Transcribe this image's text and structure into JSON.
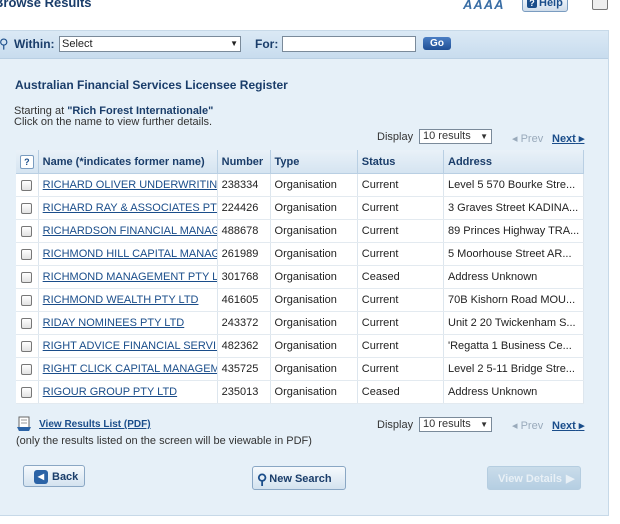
{
  "header": {
    "title": "Browse Results",
    "font_sizes": "AAAA",
    "help_label": "Help"
  },
  "search": {
    "within_label": "Within:",
    "within_selected": "Select",
    "for_label": "For:",
    "for_value": "",
    "go_label": "Go"
  },
  "register_title": "Australian Financial Services Licensee Register",
  "intro": {
    "starting_prefix": "Starting at",
    "starting_name": "\"Rich Forest Internationale\"",
    "instruction": "Click on the name to view further details."
  },
  "pagination": {
    "display_label": "Display",
    "display_value": "10 results",
    "prev_label": "Prev",
    "next_label": "Next"
  },
  "table": {
    "columns": [
      "Name (*indicates former name)",
      "Number",
      "Type",
      "Status",
      "Address"
    ],
    "rows": [
      {
        "name": "RICHARD OLIVER UNDERWRITIN...",
        "number": "238334",
        "type": "Organisation",
        "status": "Current",
        "address": "Level 5 570 Bourke Stre..."
      },
      {
        "name": "RICHARD RAY & ASSOCIATES PTY...",
        "number": "224426",
        "type": "Organisation",
        "status": "Current",
        "address": "3 Graves Street KADINA..."
      },
      {
        "name": "RICHARDSON FINANCIAL MANAG...",
        "number": "488678",
        "type": "Organisation",
        "status": "Current",
        "address": "89 Princes Highway TRA..."
      },
      {
        "name": "RICHMOND HILL CAPITAL MANAG...",
        "number": "261989",
        "type": "Organisation",
        "status": "Current",
        "address": "5 Moorhouse Street AR..."
      },
      {
        "name": "RICHMOND MANAGEMENT PTY LTD",
        "number": "301768",
        "type": "Organisation",
        "status": "Ceased",
        "address": "Address Unknown"
      },
      {
        "name": "RICHMOND WEALTH PTY LTD",
        "number": "461605",
        "type": "Organisation",
        "status": "Current",
        "address": "70B Kishorn Road MOU..."
      },
      {
        "name": "RIDAY NOMINEES PTY LTD",
        "number": "243372",
        "type": "Organisation",
        "status": "Current",
        "address": "Unit 2 20 Twickenham S..."
      },
      {
        "name": "RIGHT ADVICE FINANCIAL SERVI...",
        "number": "482362",
        "type": "Organisation",
        "status": "Current",
        "address": "'Regatta 1 Business Ce..."
      },
      {
        "name": "RIGHT CLICK CAPITAL MANAGEM...",
        "number": "435725",
        "type": "Organisation",
        "status": "Current",
        "address": "Level 2 5-11 Bridge Stre..."
      },
      {
        "name": "RIGOUR GROUP PTY LTD",
        "number": "235013",
        "type": "Organisation",
        "status": "Ceased",
        "address": "Address Unknown"
      }
    ]
  },
  "pdf": {
    "link_label": "View Results List (PDF)",
    "note": "(only the results listed on the screen will be viewable in PDF)"
  },
  "buttons": {
    "back": "Back",
    "new_search": "New Search",
    "view_details": "View Details"
  }
}
